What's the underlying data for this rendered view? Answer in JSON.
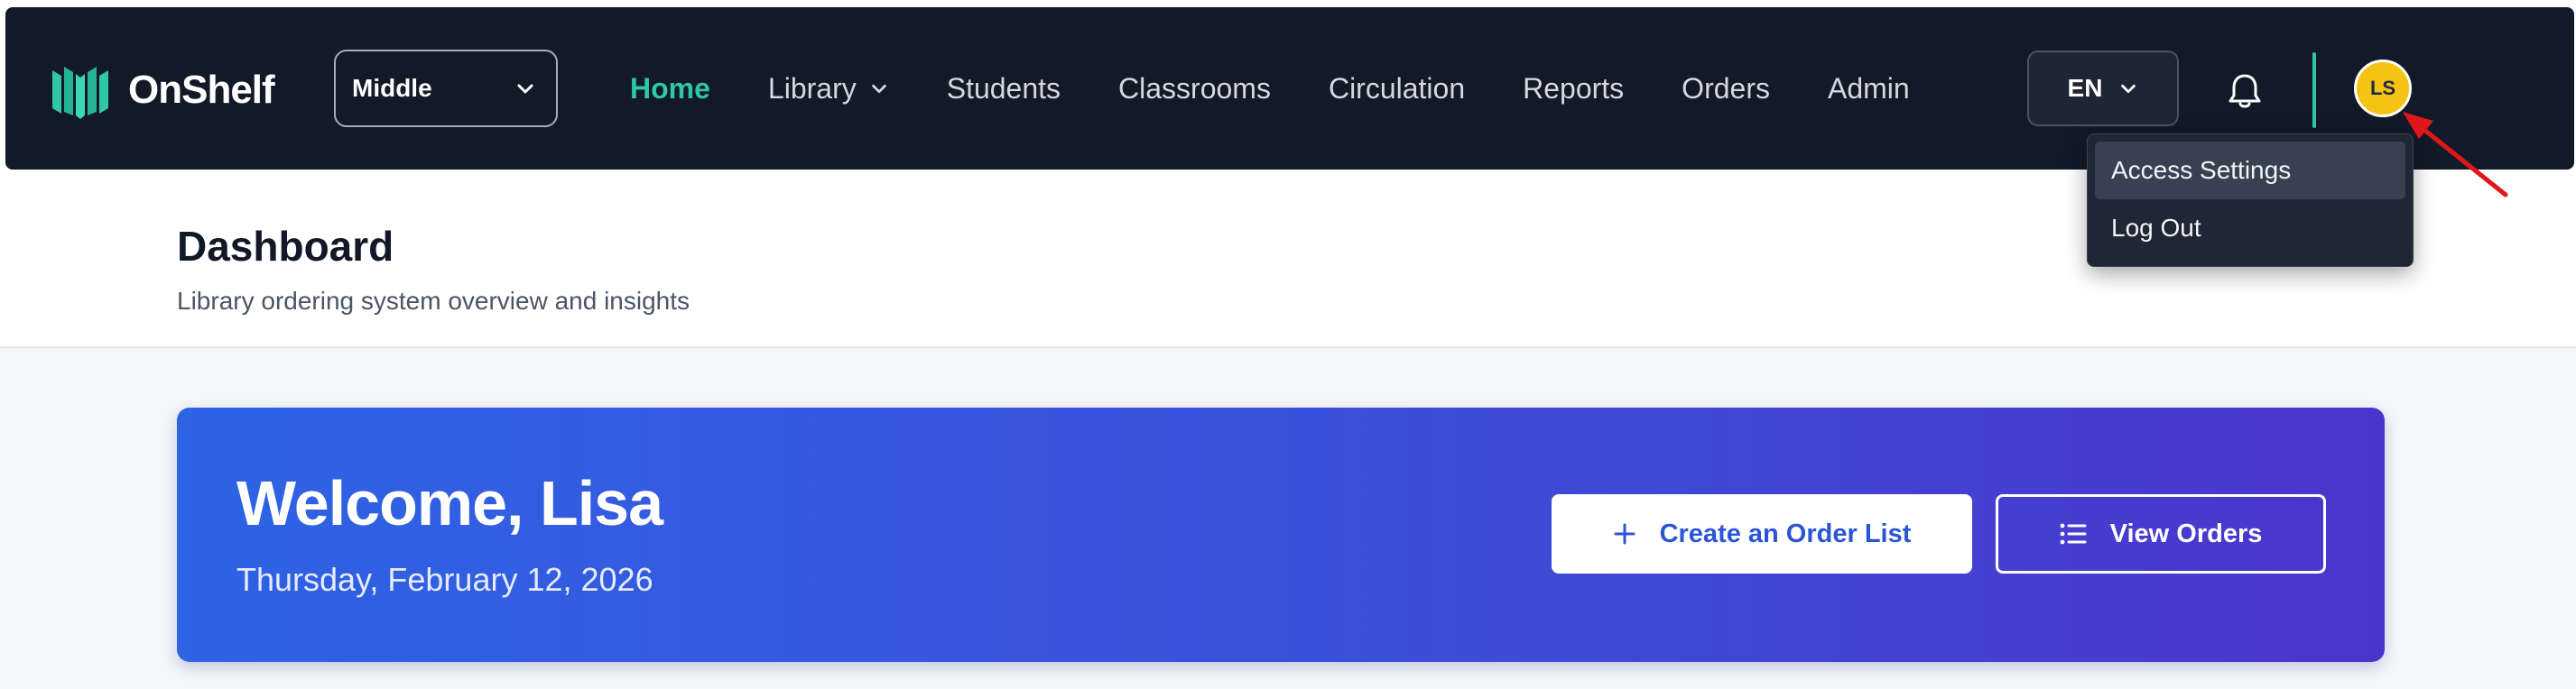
{
  "app": {
    "brand_name": "OnShelf",
    "logo_icon": "open-book-logo",
    "accent_color": "#2fc7a8"
  },
  "school_select": {
    "value": "Middle"
  },
  "nav": {
    "items": [
      {
        "label": "Home",
        "active": true
      },
      {
        "label": "Library",
        "has_dropdown": true
      },
      {
        "label": "Students"
      },
      {
        "label": "Classrooms"
      },
      {
        "label": "Circulation"
      },
      {
        "label": "Reports"
      },
      {
        "label": "Orders"
      },
      {
        "label": "Admin"
      }
    ]
  },
  "language": {
    "value": "EN"
  },
  "user": {
    "initials": "LS",
    "avatar_color": "#f5c313"
  },
  "user_menu": {
    "items": [
      {
        "label": "Access Settings",
        "highlighted": true
      },
      {
        "label": "Log Out"
      }
    ]
  },
  "page_header": {
    "title": "Dashboard",
    "subtitle": "Library ordering system overview and insights"
  },
  "welcome_banner": {
    "greeting": "Welcome, Lisa",
    "date": "Thursday, February 12, 2026",
    "gradient_start": "#2e63e4",
    "gradient_end": "#4a35cc",
    "create_button_label": "Create an Order List",
    "create_button_icon": "plus-icon",
    "view_button_label": "View Orders",
    "view_button_icon": "list-icon"
  }
}
